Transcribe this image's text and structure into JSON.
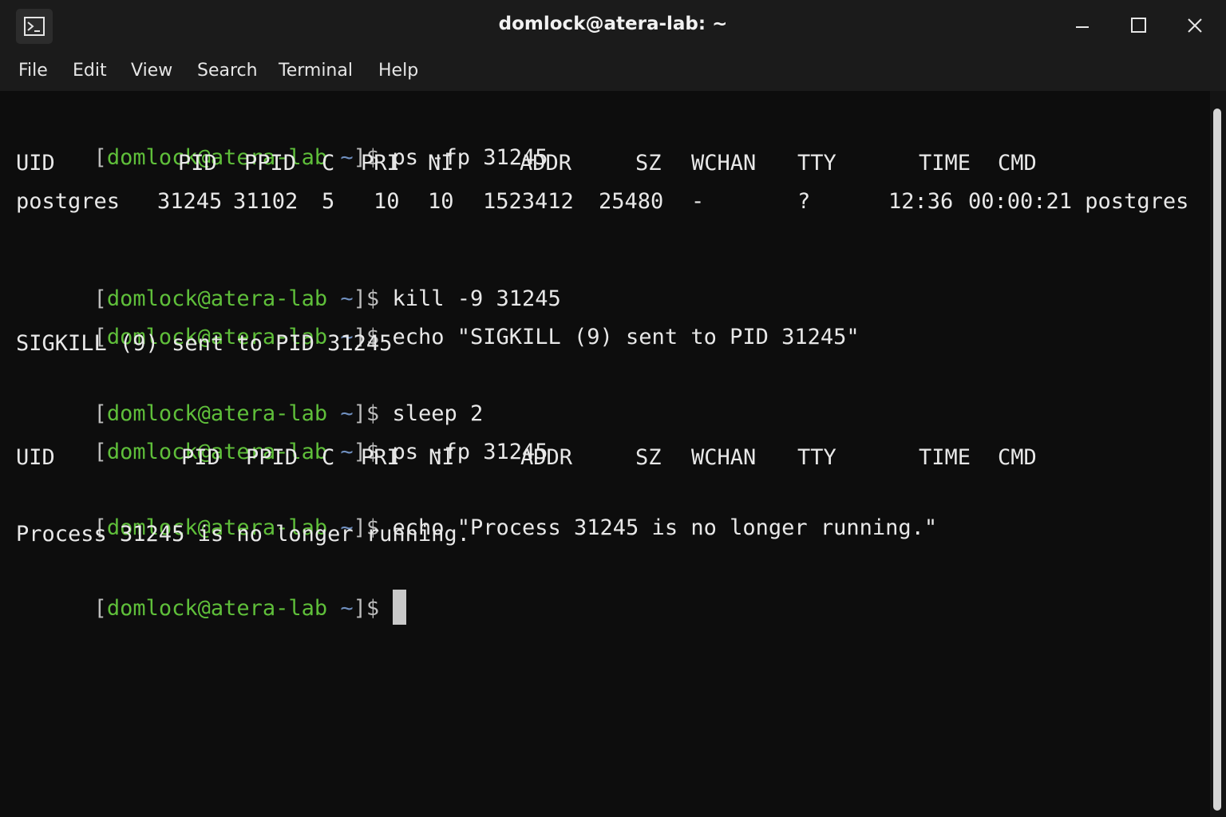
{
  "window": {
    "title": "domlock@atera-lab: ~",
    "icon": "terminal-app-icon",
    "controls": [
      "minimize-icon",
      "maximize-icon",
      "close-icon"
    ]
  },
  "menubar": {
    "items": [
      "File",
      "Edit",
      "View",
      "Search",
      "Terminal",
      "Help"
    ]
  },
  "colors": {
    "prompt_user": "#5fbf3a",
    "prompt_tilde": "#6f8fbf",
    "text": "#e8e8e8",
    "background": "#0d0d0d"
  },
  "prompt": {
    "open": "[",
    "user_host": "domlock@atera-lab",
    "dir": " ~",
    "close": "]$ "
  },
  "terminal": {
    "cmd1": "ps -fp 31245",
    "header1": [
      "UID",
      "PID",
      "PPID",
      "C",
      "PRI",
      "NI",
      "ADDR",
      "SZ",
      "WCHAN",
      "TTY",
      "TIME",
      "CMD"
    ],
    "row1": [
      "postgres",
      "31245",
      "31102",
      "5",
      "10",
      "10",
      "1523412",
      "25480",
      "-",
      "?",
      "12:36",
      "00:00:21 postgres"
    ],
    "cmd2": "kill -9 31245",
    "cmd3": "echo \"SIGKILL (9) sent to PID 31245\"",
    "out3": "SIGKILL (9) sent to PID 31245",
    "cmd4": "sleep 2",
    "cmd5": "ps -fp 31245",
    "header2": [
      "UID",
      "PID",
      "PPID",
      "C",
      "PRI",
      "NI",
      "ADDR",
      "SZ",
      "WCHAN",
      "TTY",
      "TIME",
      "CMD"
    ],
    "cmd6": "echo \"Process 31245 is no longer running.\"",
    "out6": "Process 31245 is no longer running."
  }
}
